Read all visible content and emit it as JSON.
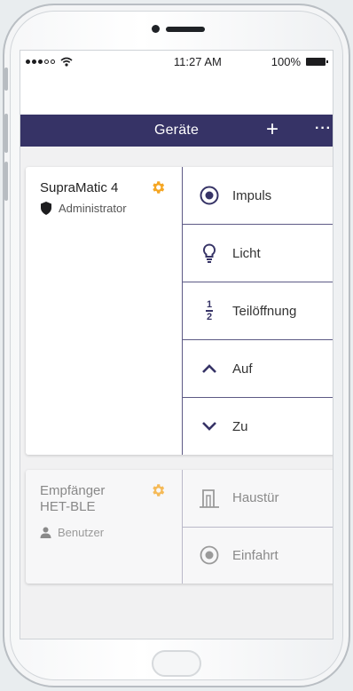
{
  "status_bar": {
    "time": "11:27 AM",
    "battery": "100%"
  },
  "navbar": {
    "title": "Geräte",
    "add": "+",
    "more": "···"
  },
  "devices": [
    {
      "name": "SupraMatic 4",
      "role": "Administrator",
      "actions": [
        "Impuls",
        "Licht",
        "Teilöffnung",
        "Auf",
        "Zu"
      ]
    },
    {
      "name_line1": "Empfänger",
      "name_line2": "HET-BLE",
      "role": "Benutzer",
      "actions": [
        "Haustür",
        "Einfahrt"
      ]
    }
  ],
  "fraction": {
    "num": "1",
    "den": "2"
  },
  "colors": {
    "nav": "#363366",
    "accent": "#f5a623",
    "divider": "#5d5a85"
  }
}
